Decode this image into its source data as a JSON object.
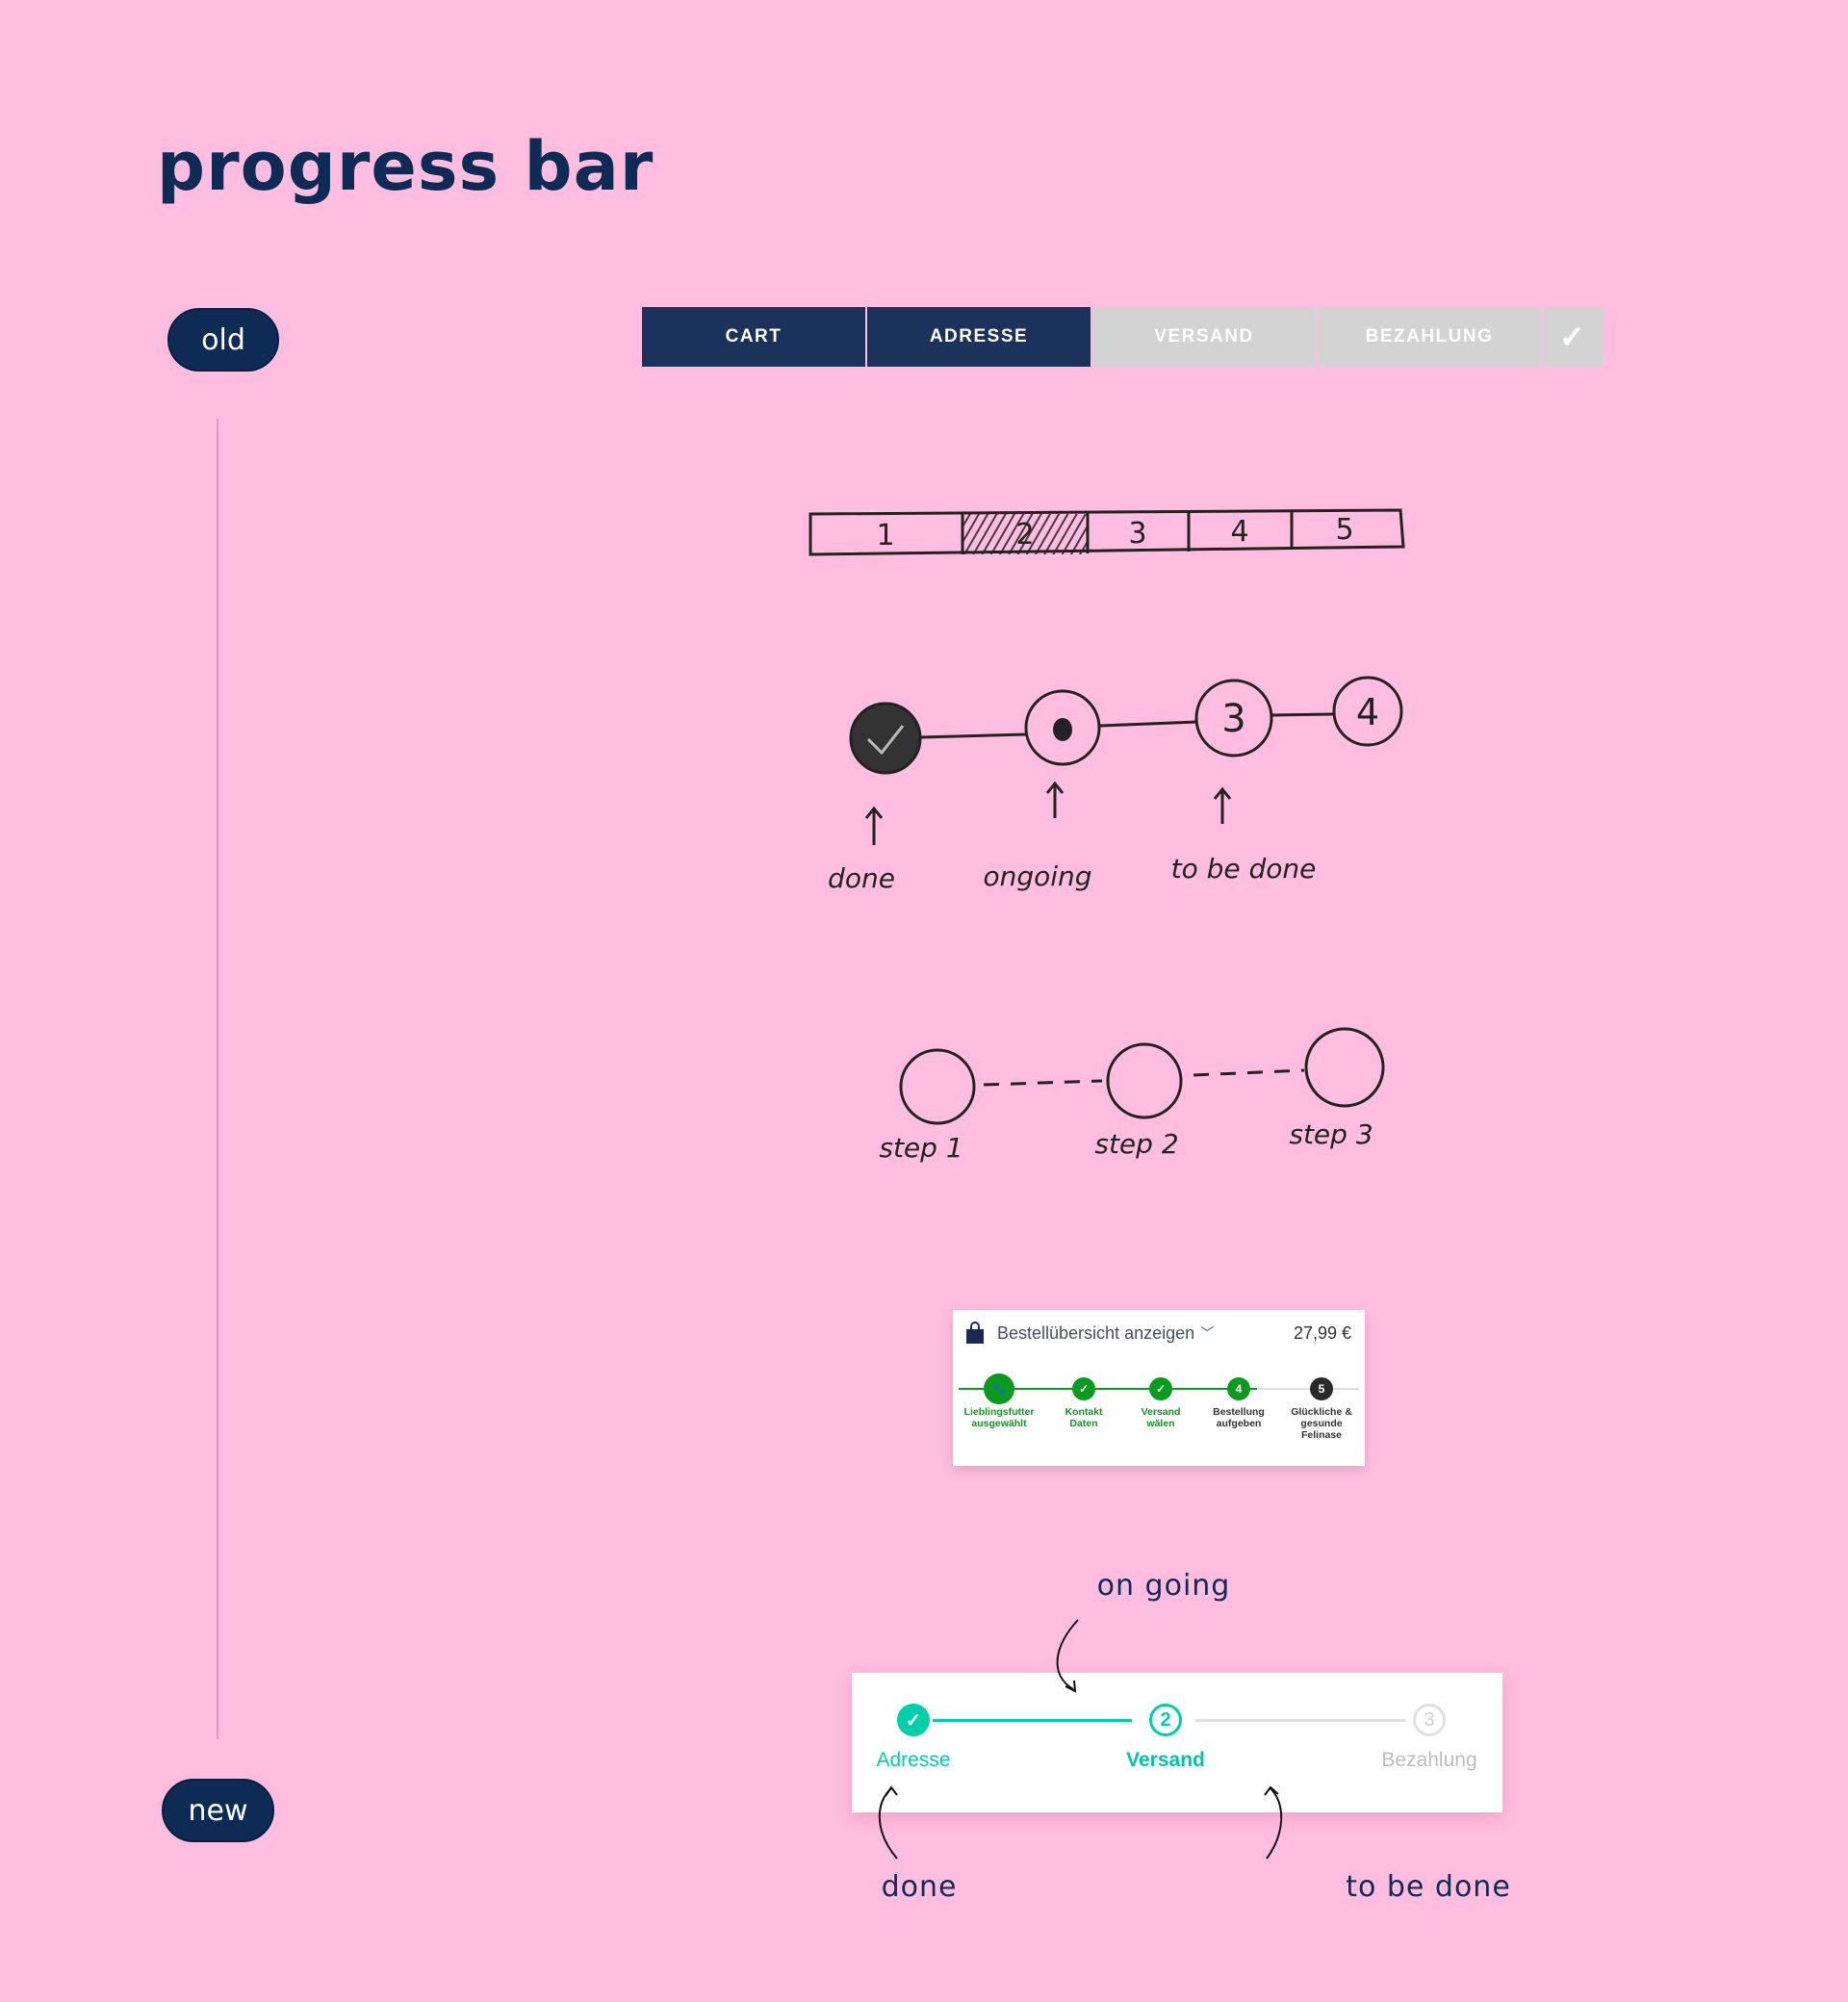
{
  "title": "progress bar",
  "labels": {
    "old": "old",
    "new": "new"
  },
  "old_bar": {
    "steps": [
      {
        "label": "CART",
        "state": "done"
      },
      {
        "label": "ADRESSE",
        "state": "done"
      },
      {
        "label": "VERSAND",
        "state": "todo"
      },
      {
        "label": "BEZAHLUNG",
        "state": "todo"
      }
    ],
    "final_icon": "check-icon",
    "final_glyph": "✓",
    "done_color": "#1b325a",
    "todo_color": "#d3d3d3"
  },
  "sketch1": {
    "steps": [
      "1",
      "2",
      "3",
      "4",
      "5"
    ],
    "active": "2"
  },
  "sketch2": {
    "steps": [
      "done-check",
      "paw",
      "3",
      "4"
    ],
    "annotations": [
      "done",
      "ongoing",
      "to be done"
    ]
  },
  "sketch3": {
    "steps": [
      "step 1",
      "step 2",
      "step 3"
    ]
  },
  "mini_screenshot": {
    "header": "Bestellübersicht anzeigen",
    "price": "27,99 €",
    "steps": [
      {
        "num": "",
        "icon": "paw-icon",
        "label1": "Lieblingsfutter",
        "label2": "ausgewählt",
        "label3": "",
        "state": "done"
      },
      {
        "num": "✓",
        "label1": "Kontakt",
        "label2": "Daten",
        "label3": "",
        "state": "done"
      },
      {
        "num": "✓",
        "label1": "Versand",
        "label2": "wälen",
        "label3": "",
        "state": "done"
      },
      {
        "num": "4",
        "label1": "Bestellung",
        "label2": "aufgeben",
        "label3": "",
        "state": "current"
      },
      {
        "num": "5",
        "label1": "Glückliche &",
        "label2": "gesunde",
        "label3": "Felinase",
        "state": "todo"
      }
    ],
    "green": "#0a9a1e",
    "dark": "#2a2a2a"
  },
  "new_bar": {
    "steps": [
      {
        "num": "✓",
        "label": "Adresse",
        "state": "done"
      },
      {
        "num": "2",
        "label": "Versand",
        "state": "ongoing"
      },
      {
        "num": "3",
        "label": "Bezahlung",
        "state": "todo"
      }
    ],
    "accent": "#00d0aa",
    "todo_color": "#c8c8c8",
    "annotations": {
      "ongoing": "on going",
      "done": "done",
      "todo": "to be done"
    }
  }
}
